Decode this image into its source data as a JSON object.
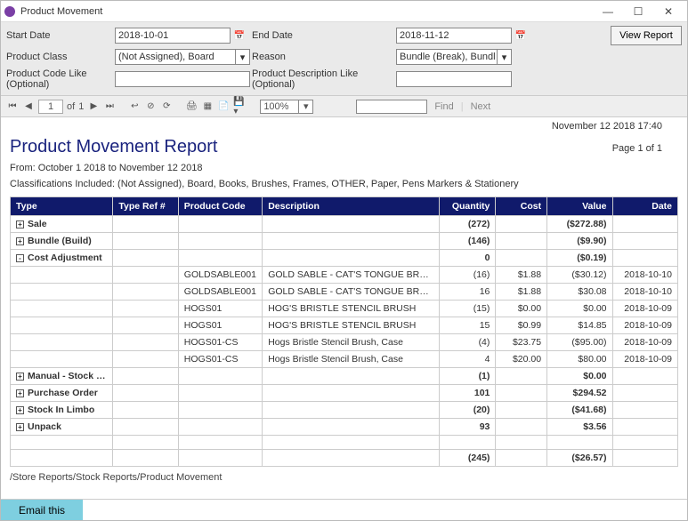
{
  "window": {
    "title": "Product Movement"
  },
  "winbtns": {
    "min": "—",
    "max": "☐",
    "close": "✕"
  },
  "filters": {
    "start_lbl": "Start Date",
    "start_val": "2018-10-01",
    "end_lbl": "End Date",
    "end_val": "2018-11-12",
    "pclass_lbl": "Product Class",
    "pclass_val": "(Not Assigned), Board",
    "reason_lbl": "Reason",
    "reason_val": "Bundle (Break), Bundl",
    "pcode_lbl": "Product Code Like (Optional)",
    "pcode_val": "",
    "pdesc_lbl": "Product Description Like (Optional)",
    "pdesc_val": "",
    "view_btn": "View Report"
  },
  "toolbar": {
    "page_current": "1",
    "of": "of",
    "page_total": "1",
    "zoom": "100%",
    "find": "Find",
    "next": "Next"
  },
  "report": {
    "timestamp": "November 12 2018 17:40",
    "title": "Product Movement Report",
    "page": "Page 1 of 1",
    "from": "From: October 1 2018 to November 12 2018",
    "classif": "Classifications Included: (Not Assigned), Board, Books, Brushes, Frames, OTHER, Paper, Pens Markers & Stationery",
    "cols": {
      "type": "Type",
      "ref": "Type Ref #",
      "code": "Product Code",
      "desc": "Description",
      "qty": "Quantity",
      "cost": "Cost",
      "val": "Value",
      "date": "Date"
    },
    "rows": [
      {
        "kind": "group",
        "type": "Sale",
        "qty": "(272)",
        "val": "($272.88)",
        "collapsed": true
      },
      {
        "kind": "group",
        "type": "Bundle (Build)",
        "qty": "(146)",
        "val": "($9.90)",
        "collapsed": true
      },
      {
        "kind": "group",
        "type": "Cost Adjustment",
        "qty": "0",
        "val": "($0.19)",
        "collapsed": false
      },
      {
        "kind": "detail",
        "code": "GOLDSABLE001",
        "desc": "GOLD SABLE - CAT'S TONGUE BRUSH",
        "qty": "(16)",
        "cost": "$1.88",
        "val": "($30.12)",
        "date": "2018-10-10"
      },
      {
        "kind": "detail",
        "code": "GOLDSABLE001",
        "desc": "GOLD SABLE - CAT'S TONGUE BRUSH",
        "qty": "16",
        "cost": "$1.88",
        "val": "$30.08",
        "date": "2018-10-10"
      },
      {
        "kind": "detail",
        "code": "HOGS01",
        "desc": "HOG'S BRISTLE STENCIL BRUSH",
        "qty": "(15)",
        "cost": "$0.00",
        "val": "$0.00",
        "date": "2018-10-09"
      },
      {
        "kind": "detail",
        "code": "HOGS01",
        "desc": "HOG'S BRISTLE STENCIL BRUSH",
        "qty": "15",
        "cost": "$0.99",
        "val": "$14.85",
        "date": "2018-10-09"
      },
      {
        "kind": "detail",
        "code": "HOGS01-CS",
        "desc": "Hogs Bristle Stencil Brush, Case",
        "qty": "(4)",
        "cost": "$23.75",
        "val": "($95.00)",
        "date": "2018-10-09"
      },
      {
        "kind": "detail",
        "code": "HOGS01-CS",
        "desc": "Hogs Bristle Stencil Brush, Case",
        "qty": "4",
        "cost": "$20.00",
        "val": "$80.00",
        "date": "2018-10-09"
      },
      {
        "kind": "group",
        "type": "Manual - Stock Wastage",
        "qty": "(1)",
        "val": "$0.00",
        "collapsed": true
      },
      {
        "kind": "group",
        "type": "Purchase Order",
        "qty": "101",
        "val": "$294.52",
        "collapsed": true
      },
      {
        "kind": "group",
        "type": "Stock In Limbo",
        "qty": "(20)",
        "val": "($41.68)",
        "collapsed": true
      },
      {
        "kind": "group",
        "type": "Unpack",
        "qty": "93",
        "val": "$3.56",
        "collapsed": true
      },
      {
        "kind": "blank"
      },
      {
        "kind": "total",
        "qty": "(245)",
        "val": "($26.57)"
      }
    ],
    "breadcrumb": "/Store Reports/Stock Reports/Product Movement"
  },
  "footer": {
    "email": "Email this"
  }
}
